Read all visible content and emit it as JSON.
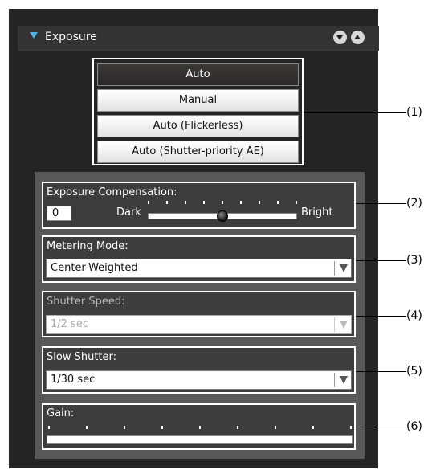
{
  "panel": {
    "title": "Exposure"
  },
  "exposure_mode": {
    "options": [
      "Auto",
      "Manual",
      "Auto (Flickerless)",
      "Auto (Shutter-priority AE)"
    ],
    "selected": "Auto"
  },
  "exposure_compensation": {
    "label": "Exposure Compensation:",
    "value": "0",
    "min_label": "Dark",
    "max_label": "Bright",
    "slider_level": 0.5
  },
  "metering_mode": {
    "label": "Metering Mode:",
    "value": "Center-Weighted"
  },
  "shutter_speed": {
    "label": "Shutter Speed:",
    "value": "1/2 sec",
    "enabled": false
  },
  "slow_shutter": {
    "label": "Slow Shutter:",
    "value": "1/30 sec"
  },
  "gain": {
    "label": "Gain:"
  },
  "callouts": [
    "(1)",
    "(2)",
    "(3)",
    "(4)",
    "(5)",
    "(6)"
  ],
  "colors": {
    "panel_bg": "#242424",
    "accent": "#4fb3e6",
    "selected_item": "#2a2828"
  }
}
